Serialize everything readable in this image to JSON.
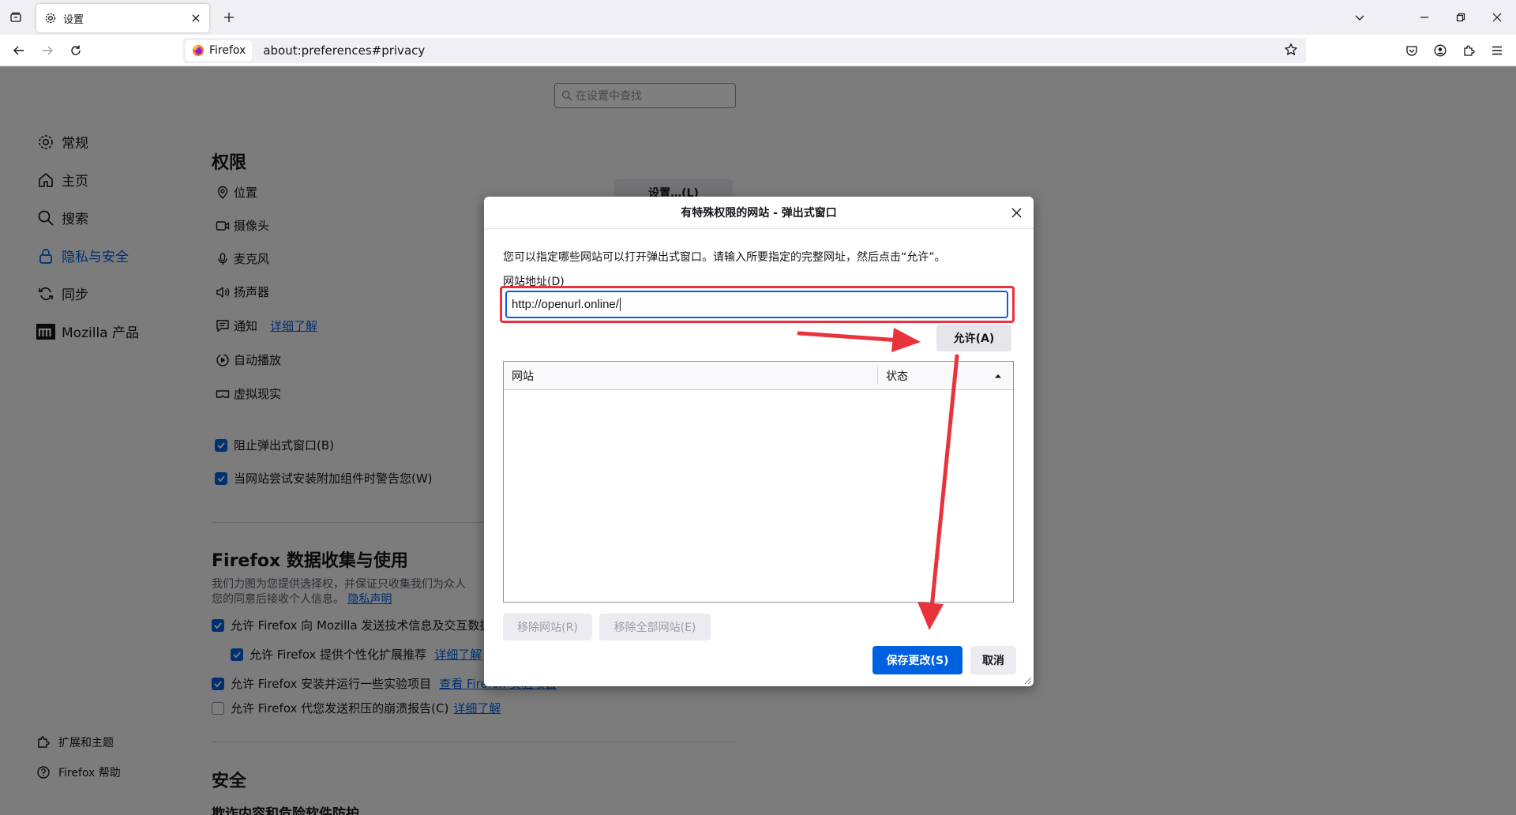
{
  "browser": {
    "tab_title": "设置",
    "identity_label": "Firefox",
    "url": "about:preferences#privacy"
  },
  "search": {
    "placeholder": "在设置中查找"
  },
  "sidebar": {
    "items": [
      {
        "label": "常规",
        "icon": "gear-icon"
      },
      {
        "label": "主页",
        "icon": "home-icon"
      },
      {
        "label": "搜索",
        "icon": "search-icon"
      },
      {
        "label": "隐私与安全",
        "icon": "lock-icon"
      },
      {
        "label": "同步",
        "icon": "sync-icon"
      },
      {
        "label": "Mozilla 产品",
        "icon": "mozilla-icon"
      }
    ],
    "footer": [
      {
        "label": "扩展和主题",
        "icon": "puzzle-icon"
      },
      {
        "label": "Firefox 帮助",
        "icon": "help-icon"
      }
    ]
  },
  "permissions": {
    "heading": "权限",
    "settings_button": "设置…(L)",
    "items": [
      {
        "label": "位置",
        "icon": "location-icon"
      },
      {
        "label": "摄像头",
        "icon": "camera-icon"
      },
      {
        "label": "麦克风",
        "icon": "microphone-icon"
      },
      {
        "label": "扬声器",
        "icon": "speaker-icon"
      },
      {
        "label": "通知",
        "icon": "notification-icon",
        "link": "详细了解"
      },
      {
        "label": "自动播放",
        "icon": "autoplay-icon"
      },
      {
        "label": "虚拟现实",
        "icon": "vr-icon"
      }
    ],
    "block_popups": "阻止弹出式窗口(B)",
    "warn_addons": "当网站尝试安装附加组件时警告您(W)"
  },
  "data_collection": {
    "heading": "Firefox 数据收集与使用",
    "desc_line1": "我们力图为您提供选择权，并保证只收集我们为众人",
    "desc_line2": "您的同意后接收个人信息。",
    "privacy_link": "隐私声明",
    "opt1": "允许 Firefox 向 Mozilla 发送技术信息及交互数据",
    "opt2": "允许 Firefox 提供个性化扩展推荐",
    "opt2_link": "详细了解",
    "opt3": "允许 Firefox 安装并运行一些实验项目",
    "opt3_link": "查看 Firefox 实验项目",
    "opt4": "允许 Firefox 代您发送积压的崩溃报告(C)",
    "opt4_link": "详细了解"
  },
  "security": {
    "heading": "安全",
    "sub": "欺诈内容和危险软件防护"
  },
  "dialog": {
    "title": "有特殊权限的网站 - 弹出式窗口",
    "description": "您可以指定哪些网站可以打开弹出式窗口。请输入所要指定的完整网址，然后点击“允许”。",
    "address_label": "网站地址(D)",
    "address_value": "http://openurl.online/",
    "allow_button": "允许(A)",
    "col_site": "网站",
    "col_status": "状态",
    "remove_site": "移除网站(R)",
    "remove_all": "移除全部网站(E)",
    "save": "保存更改(S)",
    "cancel": "取消"
  },
  "colors": {
    "accent": "#0061e0",
    "annotation": "#e8323c"
  }
}
